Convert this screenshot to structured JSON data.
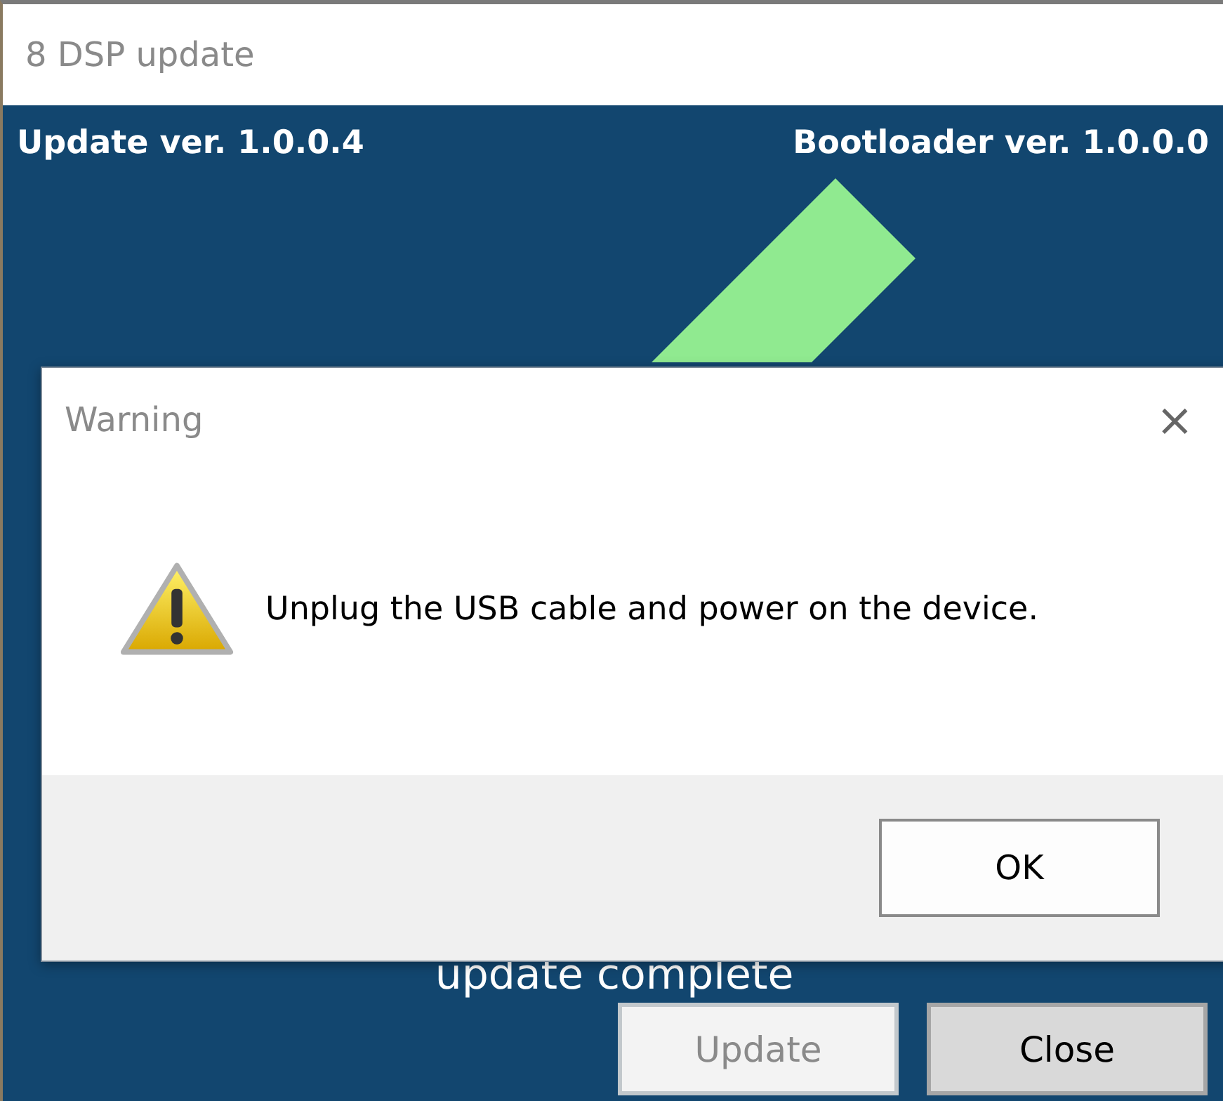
{
  "window": {
    "title": "8 DSP update"
  },
  "header": {
    "update_version": "Update ver. 1.0.0.4",
    "bootloader_version": "Bootloader ver. 1.0.0.0"
  },
  "status": "update complete",
  "buttons": [
    {
      "label": "Update",
      "disabled": true
    },
    {
      "label": "Close",
      "disabled": false
    }
  ],
  "dialog": {
    "title": "Warning",
    "close": "×",
    "message": "Unplug the USB cable and power on the device.",
    "buttons": [
      {
        "label": "OK",
        "disabled": false
      }
    ]
  }
}
